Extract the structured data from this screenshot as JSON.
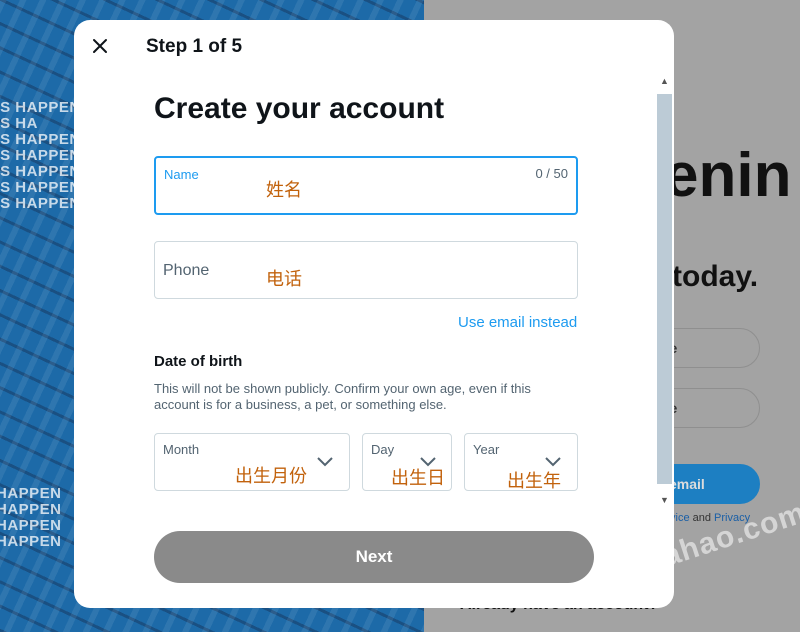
{
  "modal": {
    "step_label": "Step 1 of 5",
    "title": "Create your account"
  },
  "name_field": {
    "label": "Name",
    "counter": "0 / 50",
    "annotation": "姓名"
  },
  "phone_field": {
    "label": "Phone",
    "annotation": "电话"
  },
  "email_link": "Use email instead",
  "dob": {
    "title": "Date of birth",
    "description": "This will not be shown publicly. Confirm your own age, even if this account is for a business, a pet, or something else.",
    "month": {
      "label": "Month",
      "annotation": "出生月份"
    },
    "day": {
      "label": "Day",
      "annotation": "出生日"
    },
    "year": {
      "label": "Year",
      "annotation": "出生年"
    }
  },
  "next_label": "Next",
  "background": {
    "happening_lines": "'S HAPPEN\n'S HA\n'S HAPPEN\n'S HAPPEN\n'S HAPPEN\n'S HAPPEN\n'S HAPPEN",
    "happening_lines_bottom": "HAPPEN\nHAPPEN\nHAPPEN\nHAPPEN",
    "headline_fragment": "enin",
    "today_fragment": "today.",
    "google_fragment": "gle",
    "apple_fragment": "ple",
    "email_fragment": "email",
    "terms_prefix": "vice",
    "terms_and": "and",
    "privacy": "Privacy",
    "already": "Already have an account?",
    "watermark": "jiemahao.com"
  },
  "colors": {
    "accent": "#1d9bf0",
    "annotation": "#c2620c",
    "next_disabled": "#8a8a8a"
  }
}
